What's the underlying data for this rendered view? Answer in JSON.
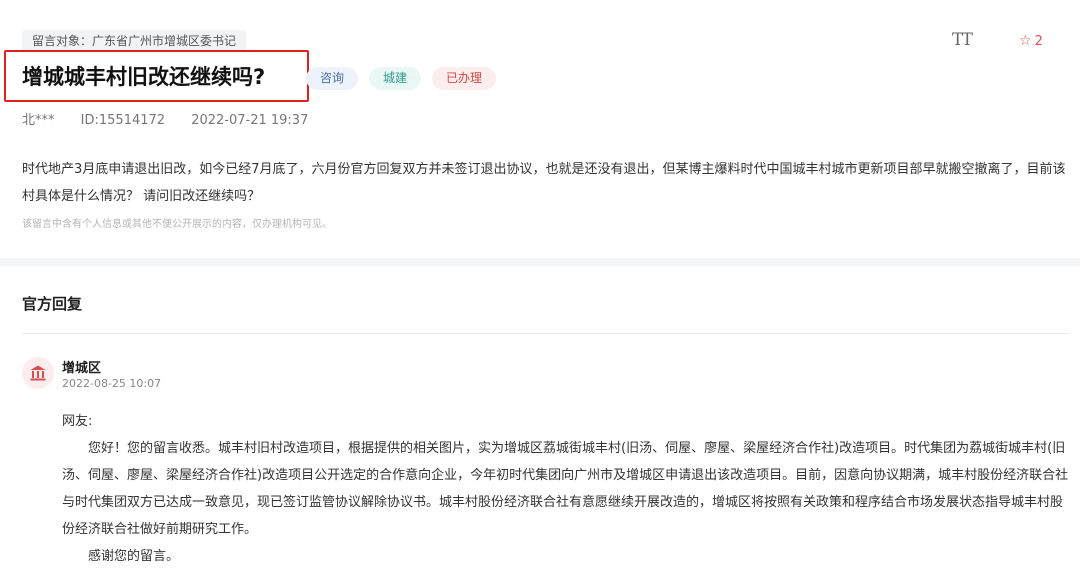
{
  "header": {
    "target_label": "留言对象：广东省广州市增城区委书记",
    "title": "增城城丰村旧改还继续吗?",
    "tags": [
      "咨询",
      "城建",
      "已办理"
    ],
    "author": "北***",
    "id_text": "ID:15514172",
    "datetime": "2022-07-21 19:37",
    "font_toggle_label": "TT",
    "favorite_count": "2"
  },
  "message": {
    "content": "时代地产3月底申请退出旧改，如今已经7月底了，六月份官方回复双方并未签订退出协议，也就是还没有退出，但某博主爆料时代中国城丰村城市更新项目部早就搬空撤离了，目前该村具体是什么情况？ 请问旧改还继续吗？",
    "notice": "该留言中含有个人信息或其他不便公开展示的内容，仅办理机构可见。"
  },
  "reply": {
    "section_title": "官方回复",
    "org_name": "增城区",
    "org_time": "2022-08-25 10:07",
    "greeting": "网友:",
    "body": "您好！您的留言收悉。城丰村旧村改造项目，根据提供的相关图片，实为增城区荔城街城丰村(旧汤、伺屋、廖屋、梁屋经济合作社)改造项目。时代集团为荔城街城丰村(旧汤、伺屋、廖屋、梁屋经济合作社)改造项目公开选定的合作意向企业，今年初时代集团向广州市及增城区申请退出该改造项目。目前，因意向协议期满，城丰村股份经济联合社与时代集团双方已达成一致意见，现已签订监管协议解除协议书。城丰村股份经济联合社有意愿继续开展改造的，增城区将按照有关政策和程序结合市场发展状态指导城丰村股份经济联合社做好前期研究工作。",
    "closing": "感谢您的留言。"
  },
  "colors": {
    "accent_red": "#e02020",
    "tag_done": "#d64545",
    "tag_build": "#2f9d8e",
    "tag_consult": "#4a6fa5"
  }
}
